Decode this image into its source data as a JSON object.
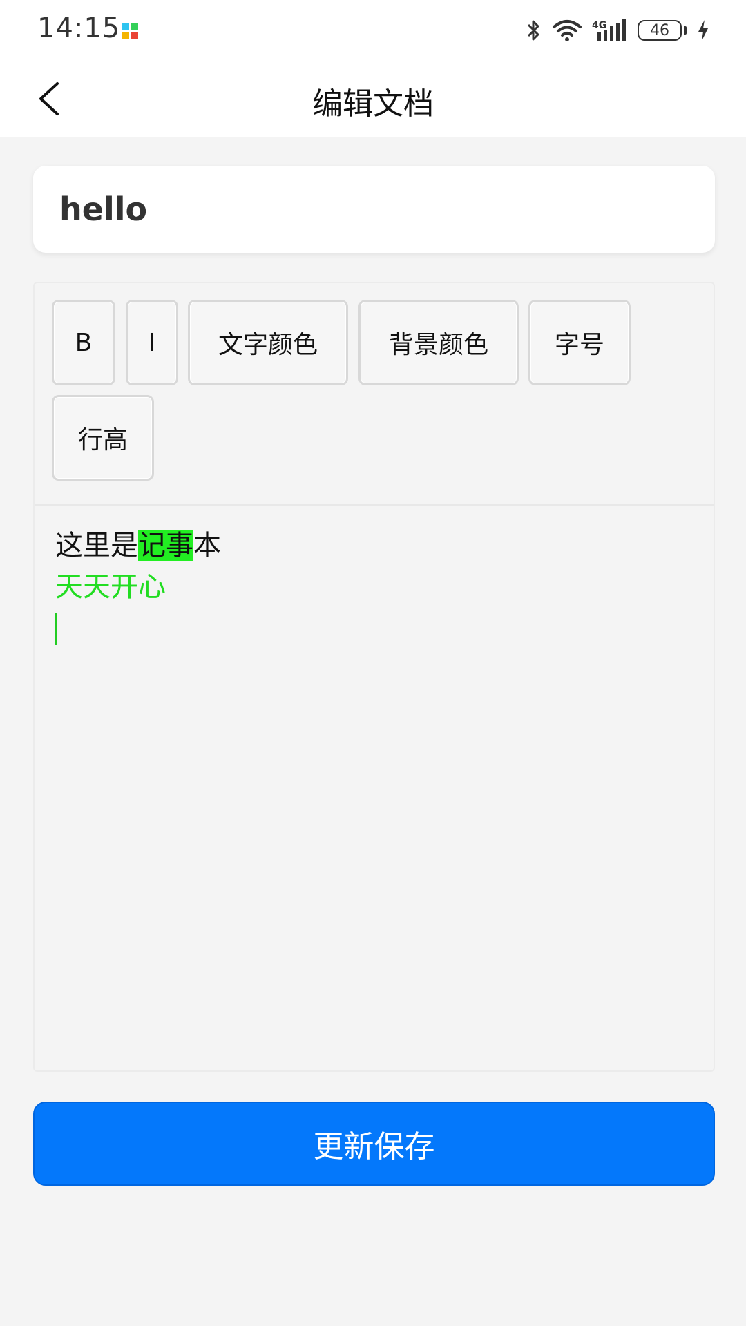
{
  "status_bar": {
    "time": "14:15",
    "battery": "46"
  },
  "header": {
    "title": "编辑文档"
  },
  "document": {
    "title_value": "hello"
  },
  "toolbar": {
    "bold": "B",
    "italic": "I",
    "text_color": "文字颜色",
    "background_color": "背景颜色",
    "font_size": "字号",
    "line_height": "行高"
  },
  "content": {
    "line1_before": "这里是",
    "line1_highlight": "记事",
    "line1_after": "本",
    "line2": "天天开心",
    "highlight_color": "#22ee22",
    "green_text_color": "#22dd22"
  },
  "actions": {
    "save_label": "更新保存"
  },
  "colors": {
    "primary": "#0478fb",
    "background": "#f4f4f4"
  }
}
